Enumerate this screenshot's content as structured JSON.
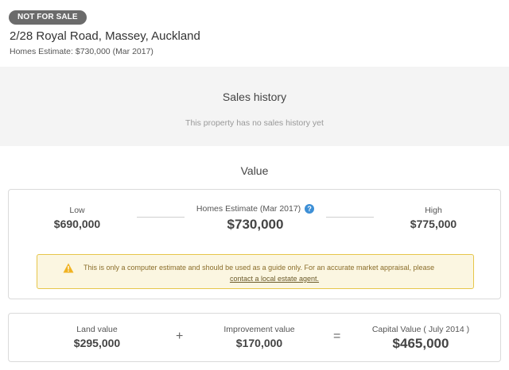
{
  "header": {
    "badge": "NOT FOR SALE",
    "address": "2/28 Royal Road, Massey, Auckland",
    "estimate": "Homes Estimate: $730,000 (Mar 2017)"
  },
  "sales_history": {
    "title": "Sales history",
    "subtitle": "This property has no sales history yet"
  },
  "value": {
    "title": "Value",
    "low_label": "Low",
    "low_value": "$690,000",
    "estimate_label": "Homes Estimate (Mar 2017)",
    "estimate_value": "$730,000",
    "help_icon": "?",
    "high_label": "High",
    "high_value": "$775,000",
    "warning_text": "This is only a computer estimate and should be used as a guide only. For an accurate market appraisal, please",
    "warning_link": "contact a local estate agent",
    "warning_suffix": "."
  },
  "capital": {
    "land_label": "Land value",
    "land_value": "$295,000",
    "plus": "+",
    "improvement_label": "Improvement value",
    "improvement_value": "$170,000",
    "equals": "=",
    "capital_label": "Capital Value ( July 2014 )",
    "capital_value": "$465,000"
  },
  "colors": {
    "badge_bg": "#6b6b6b",
    "warning_border": "#e6c64a",
    "warning_bg": "#fbf6e1",
    "help_icon": "#3d8fd6",
    "section_bg": "#f4f4f4"
  },
  "icons": {
    "help": "question-circle-icon",
    "warning": "warning-triangle-icon"
  }
}
